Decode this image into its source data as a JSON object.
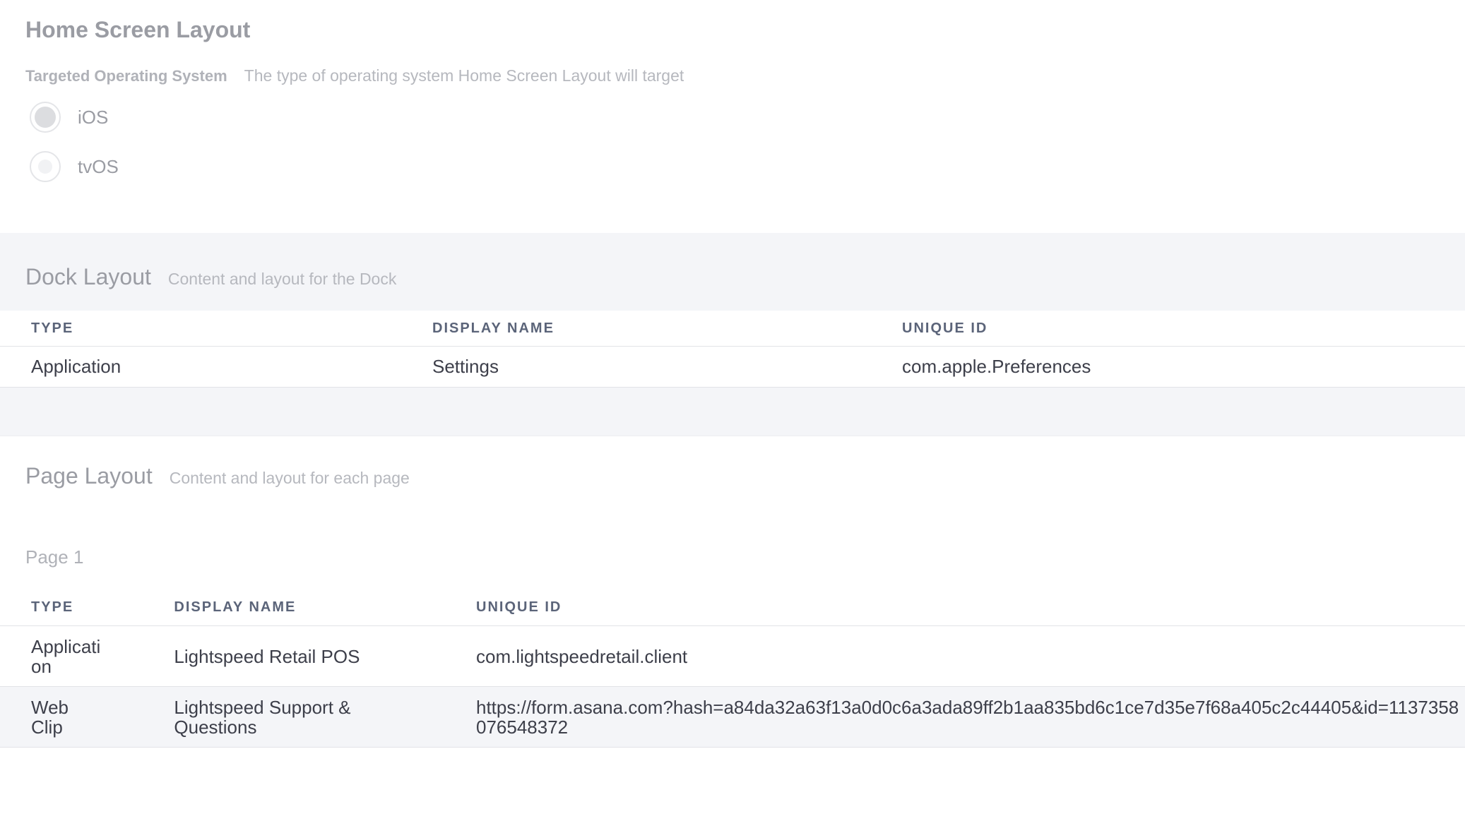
{
  "header": {
    "title": "Home Screen Layout",
    "targeted_os_label": "Targeted Operating System",
    "targeted_os_desc": "The type of operating system Home Screen Layout will target",
    "options": [
      {
        "label": "iOS",
        "selected": true
      },
      {
        "label": "tvOS",
        "selected": false
      }
    ]
  },
  "dock": {
    "title": "Dock Layout",
    "desc": "Content and layout for the Dock",
    "columns": [
      "TYPE",
      "DISPLAY NAME",
      "UNIQUE ID"
    ],
    "rows": [
      {
        "type": "Application",
        "name": "Settings",
        "id": "com.apple.Preferences"
      }
    ]
  },
  "page_layout": {
    "title": "Page Layout",
    "desc": "Content and layout for each page",
    "page_name": "Page 1",
    "columns": [
      "TYPE",
      "DISPLAY NAME",
      "UNIQUE ID"
    ],
    "rows": [
      {
        "type": "Application",
        "name": "Lightspeed Retail POS",
        "id": "com.lightspeedretail.client"
      },
      {
        "type": "Web Clip",
        "name": "Lightspeed Support & Questions",
        "id": "https://form.asana.com?hash=a84da32a63f13a0d0c6a3ada89ff2b1aa835bd6c1ce7d35e7f68a405c2c44405&id=1137358076548372"
      }
    ]
  }
}
